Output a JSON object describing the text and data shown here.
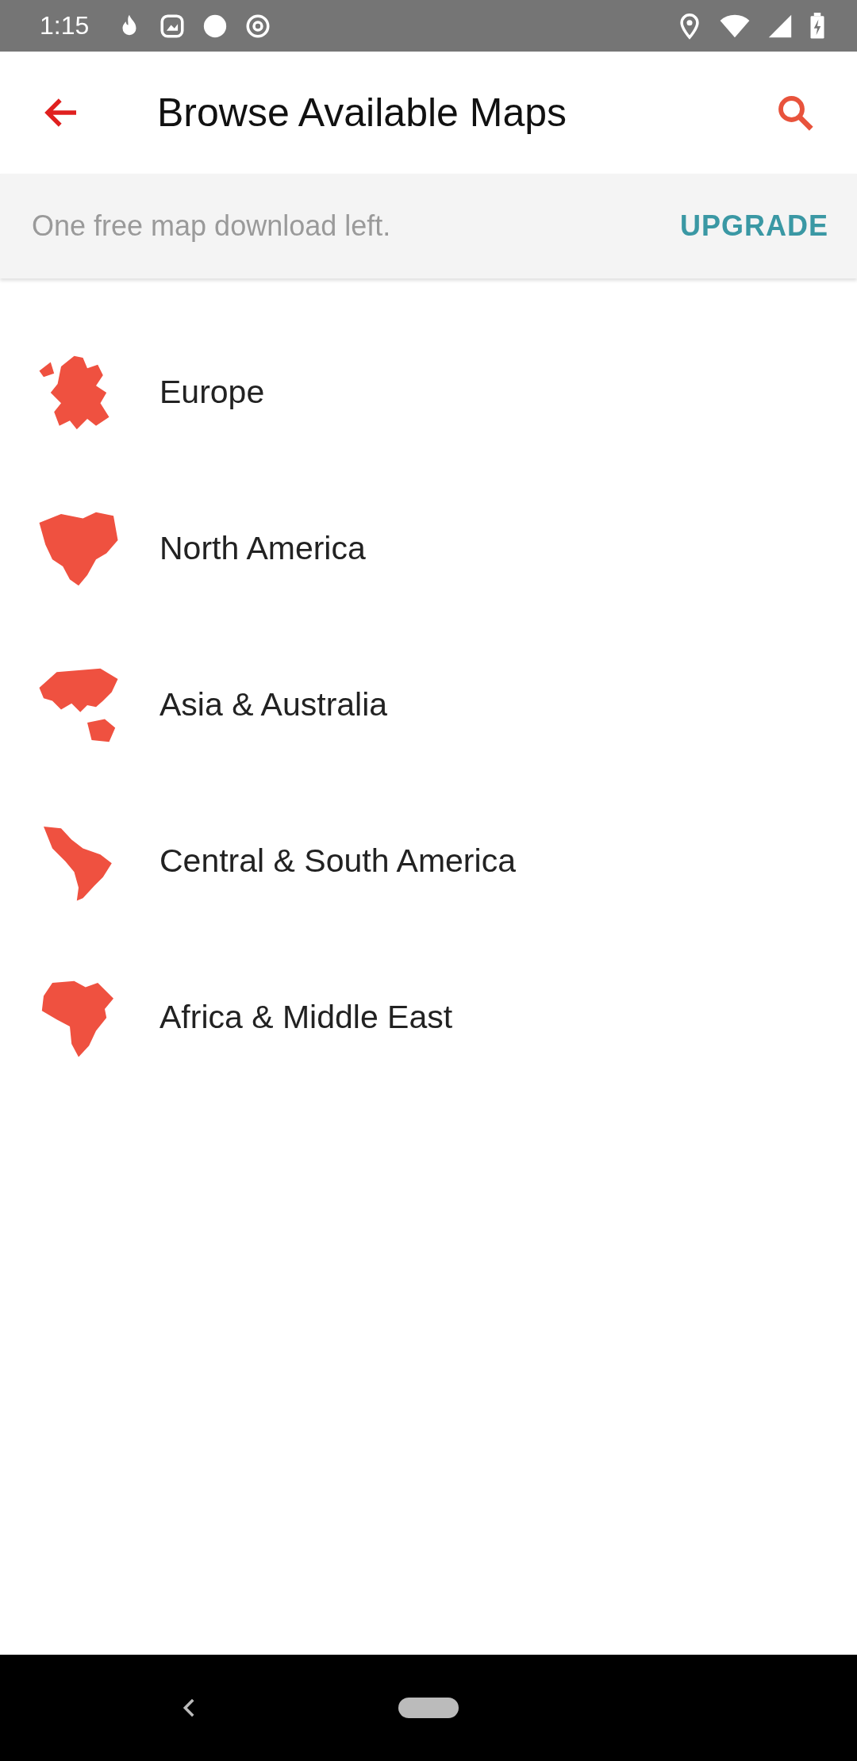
{
  "status_bar": {
    "time": "1:15"
  },
  "app_bar": {
    "title": "Browse Available Maps"
  },
  "banner": {
    "message": "One free map download left.",
    "action": "UPGRADE"
  },
  "regions": [
    {
      "name": "Europe"
    },
    {
      "name": "North America"
    },
    {
      "name": "Asia & Australia"
    },
    {
      "name": "Central & South America"
    },
    {
      "name": "Africa & Middle East"
    }
  ]
}
